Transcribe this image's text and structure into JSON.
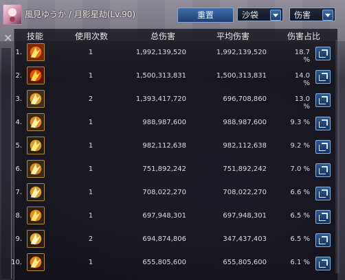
{
  "window": {
    "character_name": "風見ゆうか",
    "separator": "/",
    "guild_text": "月影星劫",
    "level": "(Lv.90)"
  },
  "toolbar": {
    "reset_label": "重置",
    "target_select": "沙袋",
    "metric_select": "伤害"
  },
  "table": {
    "headers": [
      "技能",
      "使用次数",
      "总伤害",
      "平均伤害",
      "伤害占比"
    ],
    "rows": [
      {
        "index": "1.",
        "count": "1",
        "total": "1,992,139,520",
        "avg": "1,992,139,520",
        "pct": "18.7 %"
      },
      {
        "index": "2.",
        "count": "1",
        "total": "1,500,313,831",
        "avg": "1,500,313,831",
        "pct": "14.0 %"
      },
      {
        "index": "3.",
        "count": "2",
        "total": "1,393,417,720",
        "avg": "696,708,860",
        "pct": "13.0 %"
      },
      {
        "index": "4.",
        "count": "1",
        "total": "988,987,600",
        "avg": "988,987,600",
        "pct": "9.3 %"
      },
      {
        "index": "5.",
        "count": "1",
        "total": "982,112,638",
        "avg": "982,112,638",
        "pct": "9.2 %"
      },
      {
        "index": "6.",
        "count": "1",
        "total": "751,892,242",
        "avg": "751,892,242",
        "pct": "7.0 %"
      },
      {
        "index": "7.",
        "count": "1",
        "total": "708,022,270",
        "avg": "708,022,270",
        "pct": "6.6 %"
      },
      {
        "index": "8.",
        "count": "1",
        "total": "697,948,301",
        "avg": "697,948,301",
        "pct": "6.5 %"
      },
      {
        "index": "9.",
        "count": "2",
        "total": "694,874,806",
        "avg": "347,437,403",
        "pct": "6.5 %"
      },
      {
        "index": "10.",
        "count": "1",
        "total": "655,805,600",
        "avg": "655,805,600",
        "pct": "6.1 %"
      }
    ]
  },
  "icons": {
    "close": "close-icon",
    "share": "share-icon",
    "dropdown": "chevron-down-icon",
    "skill": "skill-icon"
  },
  "colors": {
    "accent_blue": "#2d5a92",
    "text_light": "#dcdcdc",
    "skill_border": "#b38b3a"
  }
}
